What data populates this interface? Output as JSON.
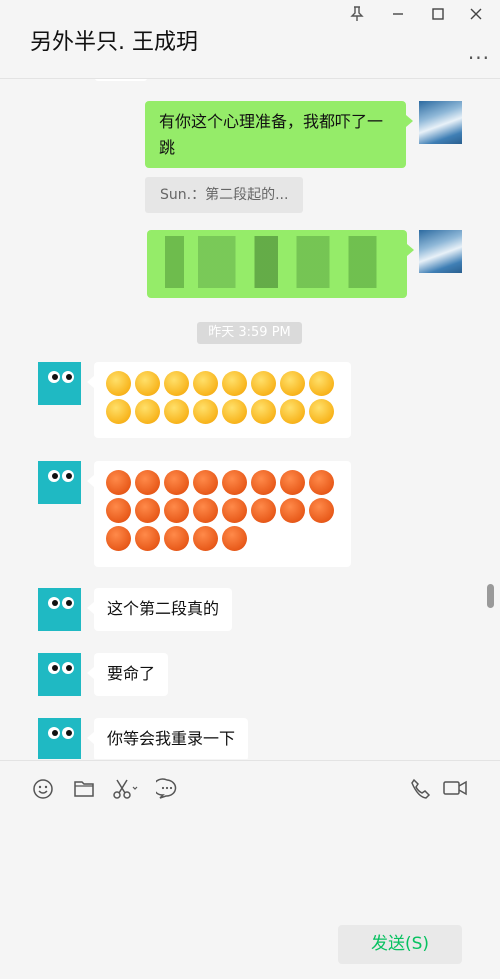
{
  "window": {
    "title": "另外半只. 王成玥",
    "pin_icon": "pin-icon",
    "minimize_icon": "minimize-icon",
    "maximize_icon": "maximize-icon",
    "close_icon": "close-icon",
    "more_label": "..."
  },
  "messages": [
    {
      "from": "me",
      "text": "有你这个心理准备，我都吓了一跳"
    },
    {
      "from": "me-quote",
      "text": "Sun.：第二段起的..."
    },
    {
      "from": "me",
      "text": "",
      "blurred": true
    },
    {
      "from": "system",
      "text": "昨天 3:59 PM"
    },
    {
      "from": "them",
      "emoji": "rofl",
      "count": 16
    },
    {
      "from": "them",
      "emoji": "angry-sweat",
      "count": 21
    },
    {
      "from": "them",
      "text": "这个第二段真的"
    },
    {
      "from": "them",
      "text": "要命了"
    },
    {
      "from": "them",
      "text": "你等会我重录一下"
    }
  ],
  "toolbar": {
    "left": [
      "emoji-icon",
      "folder-icon",
      "scissors-icon",
      "chat-history-icon"
    ],
    "right": [
      "phone-icon",
      "video-icon"
    ]
  },
  "send_label": "发送(S)",
  "colors": {
    "my_bubble": "#95ec69",
    "their_bubble": "#ffffff",
    "avatar_cyan": "#1fb9c3",
    "send_text": "#07c160",
    "background": "#f5f5f5"
  }
}
